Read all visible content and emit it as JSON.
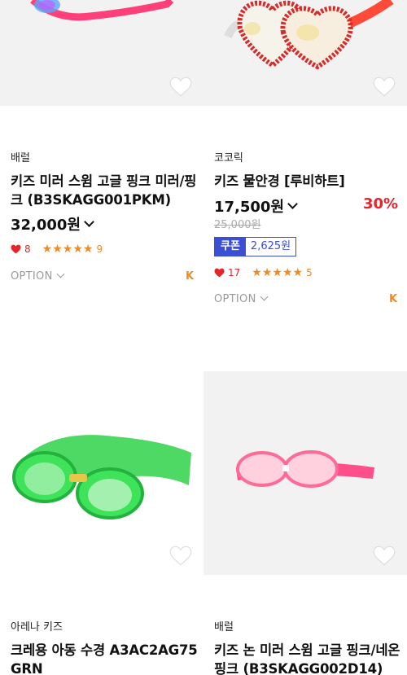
{
  "products": [
    {
      "brand": "배럴",
      "name": "키즈 미러 스윔 고글 핑크 미러/핑크 (B3SKAGG001PKM)",
      "price": "32,000원",
      "likes": "8",
      "rating": 5,
      "reviews": "9",
      "option_label": "OPTION",
      "badge": "K"
    },
    {
      "brand": "코코릭",
      "name": "키즈 물안경 [루비하트]",
      "price": "17,500원",
      "discount": "30%",
      "original_price": "25,000원",
      "coupon_label": "쿠폰",
      "coupon_value": "2,625원",
      "likes": "17",
      "rating": 5,
      "reviews": "5",
      "option_label": "OPTION",
      "badge": "K"
    },
    {
      "brand": "아레나 키즈",
      "name": "크레용 아동 수경 A3AC2AG75GRN"
    },
    {
      "brand": "배럴",
      "name": "키즈 논 미러 스윔 고글 핑크/네온핑크 (B3SKAGG002D14)"
    }
  ],
  "icons": {
    "wishlist": "heart-outline-icon",
    "like": "heart-filled-icon",
    "star": "star-icon",
    "dropdown": "chevron-down-icon"
  },
  "colors": {
    "accent_red": "#e8232c",
    "star_orange": "#f08a24",
    "coupon_blue": "#3b4fd6"
  }
}
